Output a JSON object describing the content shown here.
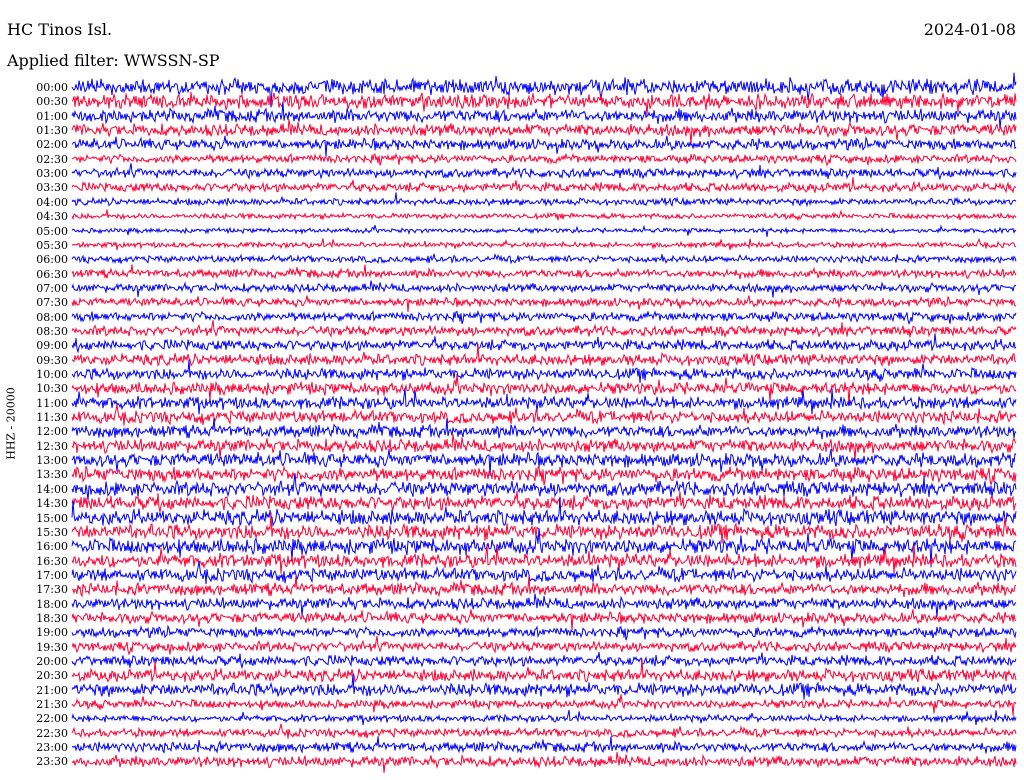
{
  "header": {
    "station": "HC Tinos Isl.",
    "date": "2024-01-08",
    "filter": "Applied filter: WWSSN-SP"
  },
  "axis": {
    "ylabel": "HHZ - 20000"
  },
  "colors": {
    "odd_trace": "#0000ff",
    "even_trace": "#ff0033"
  },
  "chart_data": {
    "type": "line",
    "title": "HC Tinos Isl.",
    "subtitle": "Applied filter: WWSSN-SP",
    "ylabel": "HHZ - 20000",
    "xlabel": "",
    "grid": false,
    "legend": "none",
    "row_labels": [
      "00:00",
      "00:30",
      "01:00",
      "01:30",
      "02:00",
      "02:30",
      "03:00",
      "03:30",
      "04:00",
      "04:30",
      "05:00",
      "05:30",
      "06:00",
      "06:30",
      "07:00",
      "07:30",
      "08:00",
      "08:30",
      "09:00",
      "09:30",
      "10:00",
      "10:30",
      "11:00",
      "11:30",
      "12:00",
      "12:30",
      "13:00",
      "13:30",
      "14:00",
      "14:30",
      "15:00",
      "15:30",
      "16:00",
      "16:30",
      "17:00",
      "17:30",
      "18:00",
      "18:30",
      "19:00",
      "19:30",
      "20:00",
      "20:30",
      "21:00",
      "21:30",
      "22:00",
      "22:30",
      "23:00",
      "23:30"
    ],
    "series_colors": [
      "#0000ff",
      "#ff0033"
    ],
    "relative_amplitude": [
      1.0,
      0.95,
      0.85,
      0.8,
      0.7,
      0.55,
      0.6,
      0.6,
      0.45,
      0.35,
      0.3,
      0.35,
      0.45,
      0.55,
      0.55,
      0.55,
      0.6,
      0.65,
      0.7,
      0.75,
      0.75,
      0.8,
      0.8,
      0.8,
      0.8,
      0.85,
      0.9,
      0.9,
      0.95,
      0.95,
      1.0,
      1.0,
      1.0,
      0.9,
      0.85,
      0.8,
      0.75,
      0.7,
      0.65,
      0.65,
      0.7,
      0.8,
      0.85,
      0.55,
      0.45,
      0.55,
      0.65,
      0.7
    ]
  }
}
